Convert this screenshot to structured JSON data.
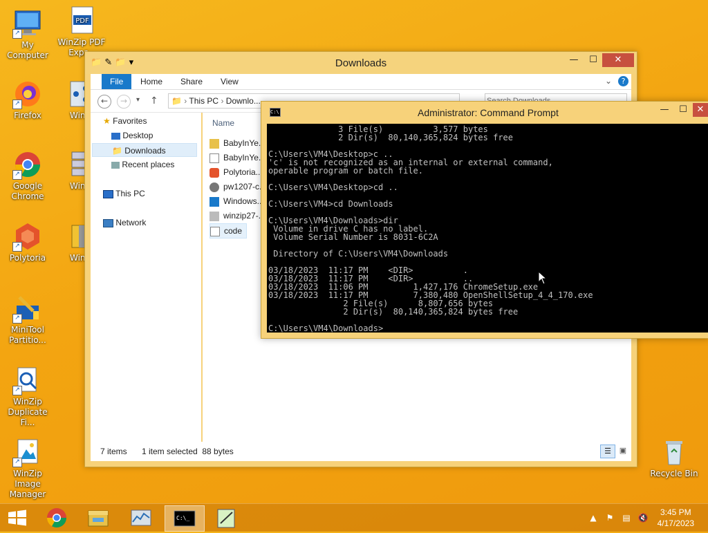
{
  "desktop": {
    "icons": [
      {
        "label": "My Computer"
      },
      {
        "label": "WinZip PDF Expr..."
      },
      {
        "label": "Firefox"
      },
      {
        "label": "Win..."
      },
      {
        "label": "Google Chrome"
      },
      {
        "label": "Win..."
      },
      {
        "label": "Polytoria"
      },
      {
        "label": "Win..."
      },
      {
        "label": "MiniTool Partitio..."
      },
      {
        "label": "WinZip Duplicate Fi..."
      },
      {
        "label": "WinZip Image Manager"
      },
      {
        "label": "Recycle Bin"
      }
    ]
  },
  "explorer": {
    "title": "Downloads",
    "ribbon_tabs": [
      "File",
      "Home",
      "Share",
      "View"
    ],
    "address": [
      "This PC",
      "Downlo..."
    ],
    "search_placeholder": "Search Downloads",
    "nav": {
      "favorites": "Favorites",
      "desktop": "Desktop",
      "downloads": "Downloads",
      "recent": "Recent places",
      "thispc": "This PC",
      "network": "Network"
    },
    "column_name": "Name",
    "files": [
      "BabyInYe...",
      "BabyInYe...",
      "Polytoria...",
      "pw1207-c...",
      "Windows...",
      "winzip27-...",
      "code"
    ],
    "status": {
      "items": "7 items",
      "selected": "1 item selected  88 bytes"
    }
  },
  "cmd": {
    "title": "Administrator:  Command Prompt",
    "output": "              3 File(s)          3,577 bytes\n              2 Dir(s)  80,140,365,824 bytes free\n\nC:\\Users\\VM4\\Desktop>c ..\n'c' is not recognized as an internal or external command,\noperable program or batch file.\n\nC:\\Users\\VM4\\Desktop>cd ..\n\nC:\\Users\\VM4>cd Downloads\n\nC:\\Users\\VM4\\Downloads>dir\n Volume in drive C has no label.\n Volume Serial Number is 8031-6C2A\n\n Directory of C:\\Users\\VM4\\Downloads\n\n03/18/2023  11:17 PM    <DIR>          .\n03/18/2023  11:17 PM    <DIR>          ..\n03/18/2023  11:06 PM         1,427,176 ChromeSetup.exe\n03/18/2023  11:17 PM         7,380,480 OpenShellSetup_4_4_170.exe\n               2 File(s)      8,807,656 bytes\n               2 Dir(s)  80,140,365,824 bytes free\n\nC:\\Users\\VM4\\Downloads>"
  },
  "taskbar": {
    "time": "3:45 PM",
    "date": "4/17/2023"
  },
  "colors": {
    "file_tab": "#1979ca",
    "desktop": "#f3a511",
    "close": "#c7503f"
  }
}
